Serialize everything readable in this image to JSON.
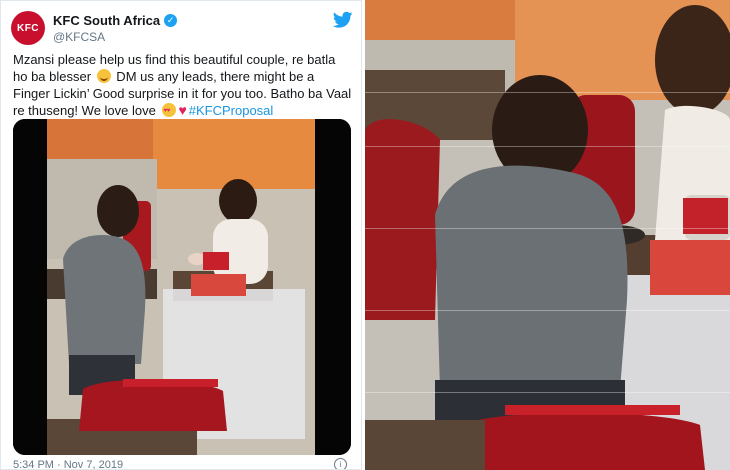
{
  "tweet": {
    "avatar_text": "KFC",
    "display_name": "KFC South Africa",
    "handle": "@KFCSA",
    "text_part1": "Mzansi please help us find this beautiful couple, re batla ho ba blesser",
    "text_part2": " DM us any leads, there might be a Finger Lickin’ Good surprise in it for you too. Batho ba Vaal re thuseng! We love love ",
    "hashtag": "#KFCProposal",
    "timestamp": "5:34 PM · Nov 7, 2019",
    "icons": [
      "kfc-logo-icon",
      "verified-badge-icon",
      "twitter-bird-icon",
      "smiling-face-icon",
      "heart-eyes-icon",
      "red-heart-icon",
      "info-icon"
    ],
    "accent_color": "#1da1f2"
  },
  "media": {
    "description_icons": [
      "proposal-photo"
    ]
  }
}
